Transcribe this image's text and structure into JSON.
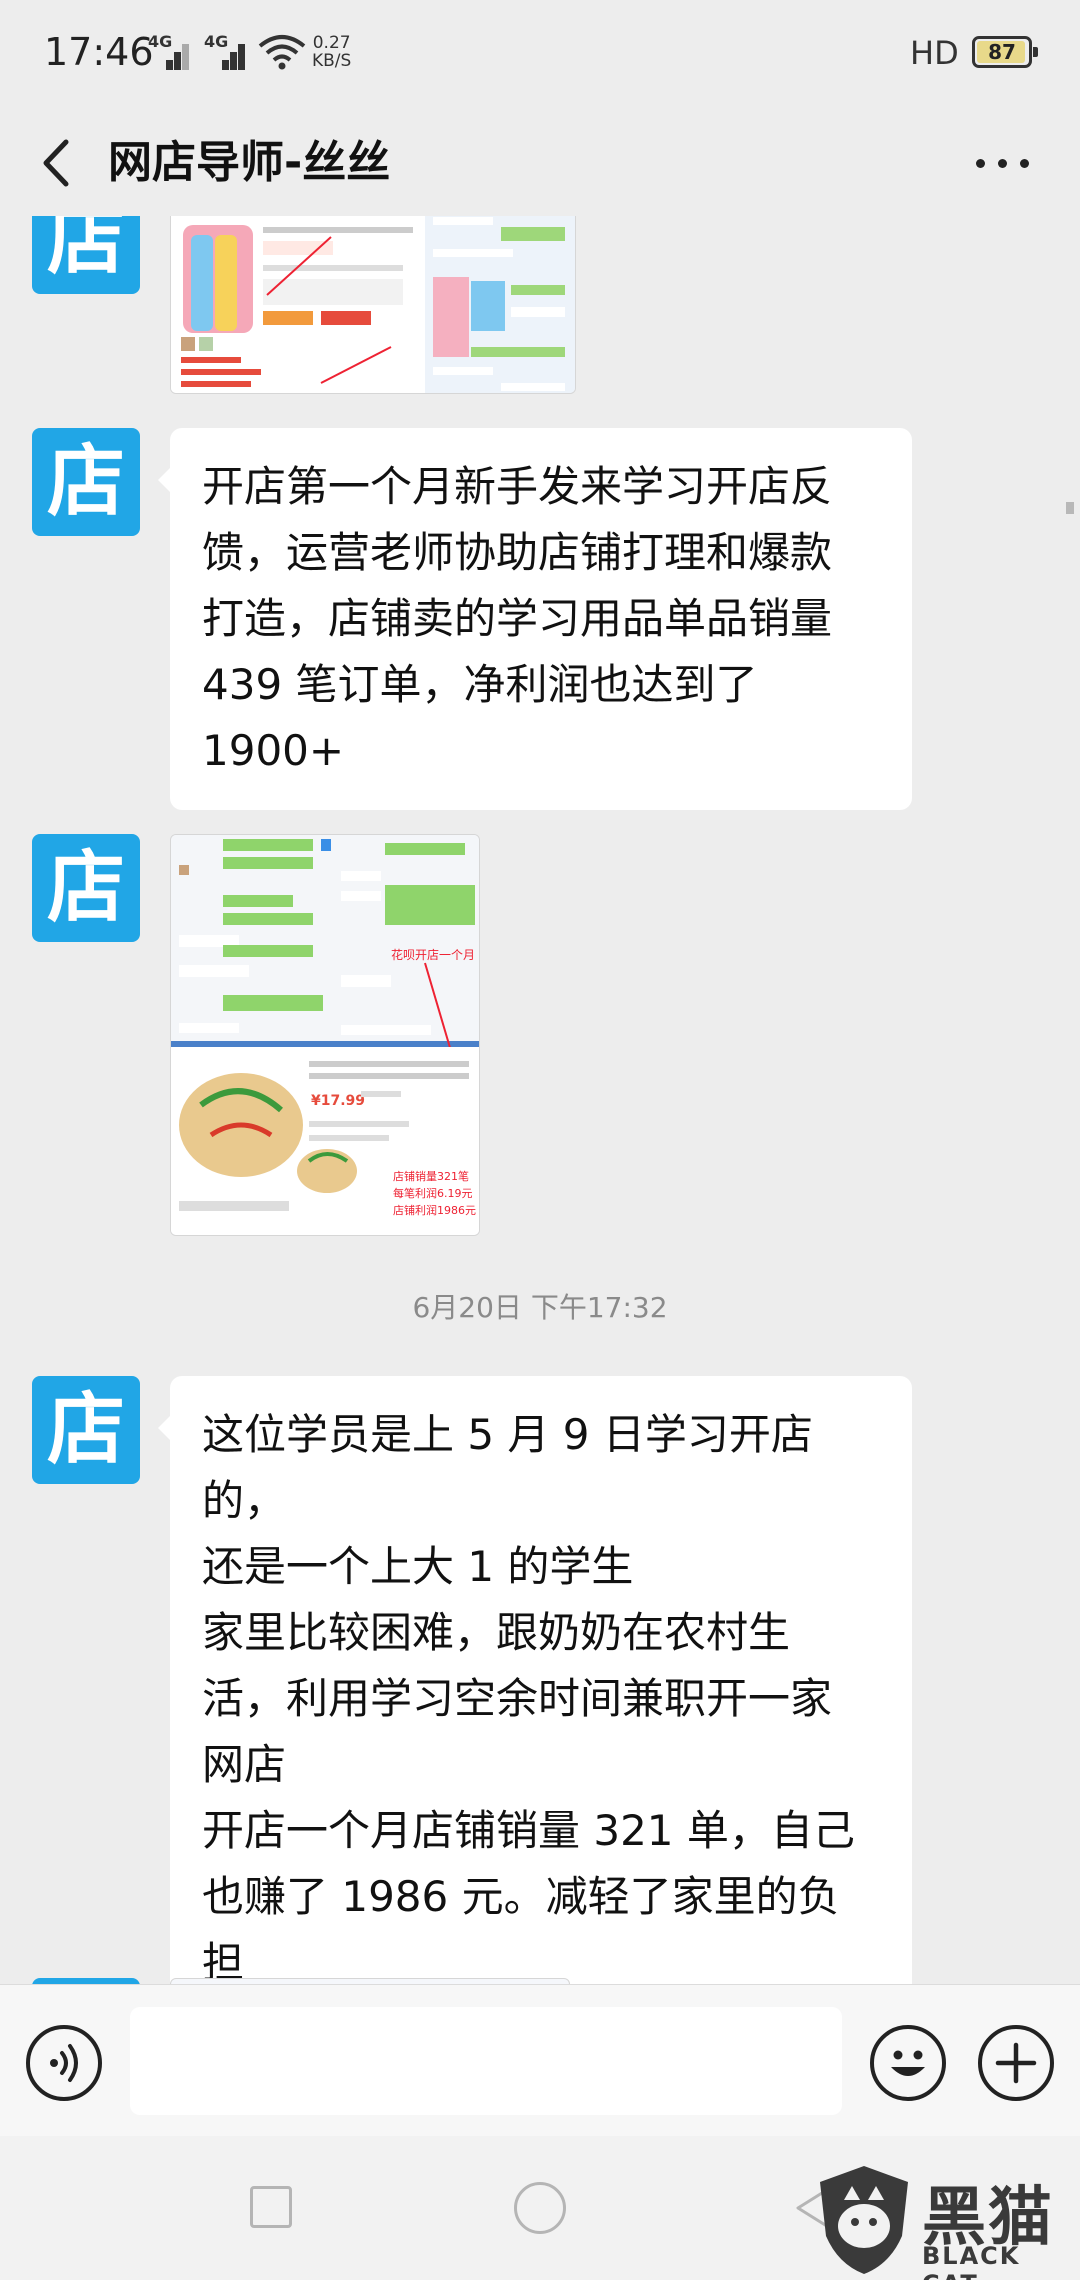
{
  "status_bar": {
    "time": "17:46",
    "signal1_label": "4G",
    "signal2_label": "4G",
    "speed_value": "0.27",
    "speed_unit": "KB/S",
    "hd_label": "HD",
    "battery_level": "87"
  },
  "title_bar": {
    "title": "网店导师-丝丝",
    "back_icon": "chevron-left-icon",
    "more_icon": "more-dots-icon"
  },
  "avatar_char": "店",
  "messages": {
    "text1": [
      "开店第一个月新手发来学习开店反",
      "馈，运营老师协助店铺打理和爆款",
      "打造，店铺卖的学习用品单品销量",
      "439 笔订单，净利润也达到了",
      "1900+"
    ],
    "image2_annotations": {
      "caption": "花呗开店一个月",
      "price": "¥17.99",
      "line1": "店铺销量321笔",
      "line2": "每笔利润6.19元",
      "line3": "店铺利润1986元"
    },
    "timestamp": "6月20日 下午17:32",
    "text3": [
      "这位学员是上 5 月 9 日学习开店的，",
      "还是一个上大 1 的学生",
      "家里比较困难，跟奶奶在农村生",
      "活，利用学习空余时间兼职开一家",
      "网店",
      "开店一个月店铺销量 321 单，自己",
      "也赚了 1986 元。减轻了家里的负",
      "担"
    ]
  },
  "input_bar": {
    "voice_icon": "voice-icon",
    "emoji_icon": "emoji-icon",
    "plus_icon": "plus-icon"
  },
  "watermark": {
    "text": "黑猫",
    "sub": "BLACK CAT"
  }
}
